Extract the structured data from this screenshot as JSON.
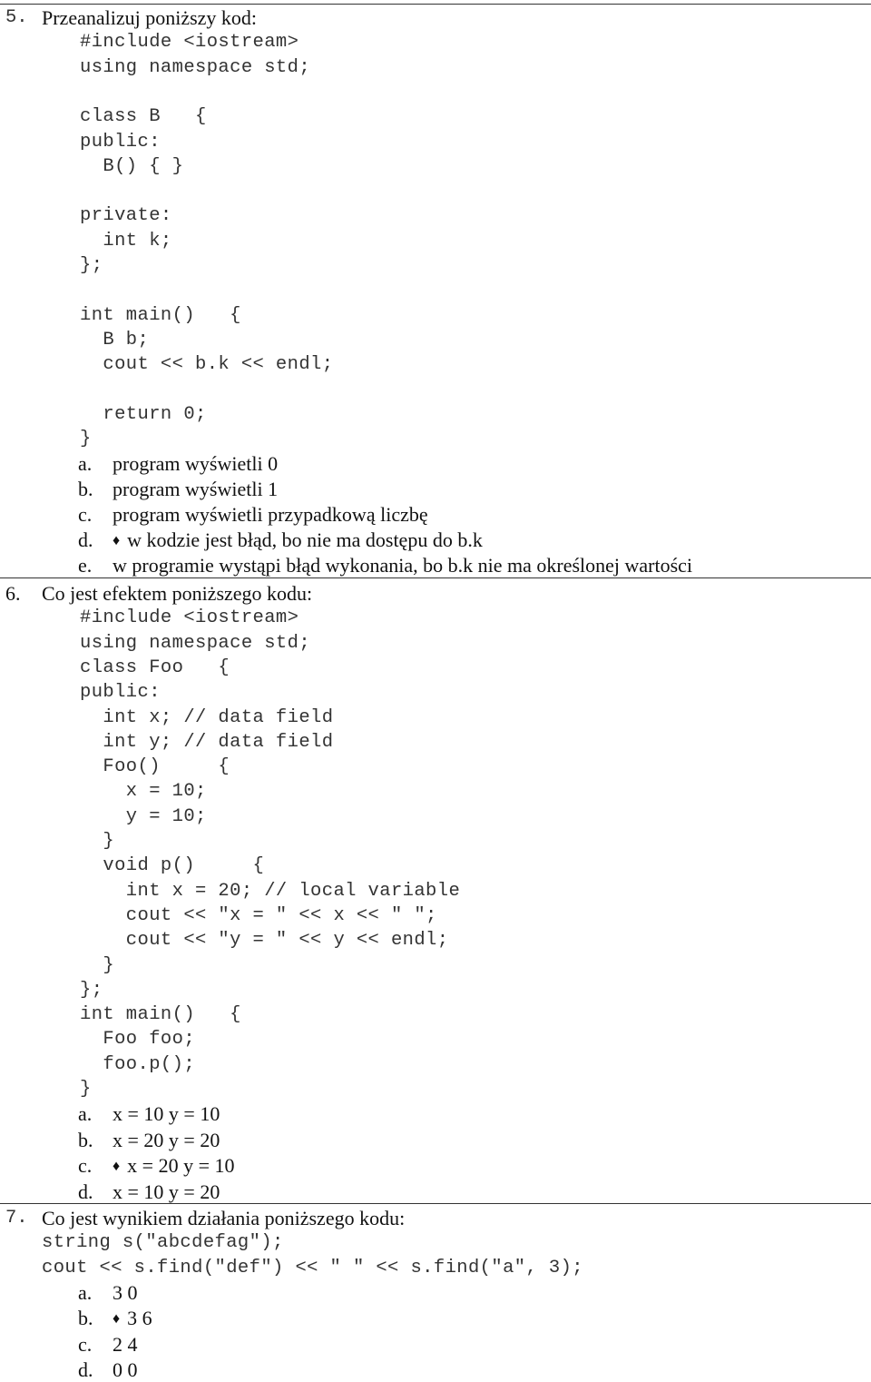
{
  "questions": [
    {
      "number": "5.",
      "prompt": "Przeanalizuj poniższy kod:",
      "code": [
        "#include <iostream>",
        "using namespace std;",
        "",
        "class B   {",
        "public:",
        "  B() { }",
        "",
        "private:",
        "  int k;",
        "};",
        "",
        "int main()   {",
        "  B b;",
        "  cout << b.k << endl;",
        "",
        "  return 0;",
        "}"
      ],
      "options": [
        {
          "letter": "a.",
          "text": "program wyświetli 0",
          "marked": false
        },
        {
          "letter": "b.",
          "text": "program wyświetli 1",
          "marked": false
        },
        {
          "letter": "c.",
          "text": "program wyświetli przypadkową liczbę",
          "marked": false
        },
        {
          "letter": "d.",
          "text": "w kodzie jest błąd, bo nie ma dostępu do b.k",
          "marked": true
        },
        {
          "letter": "e.",
          "text": "w programie wystąpi błąd wykonania, bo b.k nie ma określonej wartości",
          "marked": false
        }
      ]
    },
    {
      "number": "6.",
      "prompt": "Co jest efektem poniższego kodu:",
      "code": [
        "#include <iostream>",
        "using namespace std;",
        "class Foo   {",
        "public:",
        "  int x; // data field",
        "  int y; // data field",
        "  Foo()     {",
        "    x = 10;",
        "    y = 10;",
        "  }",
        "  void p()     {",
        "    int x = 20; // local variable",
        "    cout << \"x = \" << x << \" \";",
        "    cout << \"y = \" << y << endl;",
        "  }",
        "};",
        "int main()   {",
        "  Foo foo;",
        "  foo.p();",
        "}"
      ],
      "options": [
        {
          "letter": "a.",
          "text": "x = 10 y = 10",
          "marked": false
        },
        {
          "letter": "b.",
          "text": "x = 20 y = 20",
          "marked": false
        },
        {
          "letter": "c.",
          "text": "x = 20 y = 10",
          "marked": true
        },
        {
          "letter": "d.",
          "text": "x = 10 y = 20",
          "marked": false
        }
      ]
    },
    {
      "number": "7.",
      "prompt": "Co jest wynikiem działania poniższego kodu:",
      "code": [
        "string s(\"abcdefag\");",
        "cout << s.find(\"def\") << \" \" << s.find(\"a\", 3);"
      ],
      "options": [
        {
          "letter": "a.",
          "text": "3 0",
          "marked": false
        },
        {
          "letter": "b.",
          "text": "3 6",
          "marked": true
        },
        {
          "letter": "c.",
          "text": "2 4",
          "marked": false
        },
        {
          "letter": "d.",
          "text": "0 0",
          "marked": false
        }
      ]
    }
  ],
  "marker_icon": "♦"
}
